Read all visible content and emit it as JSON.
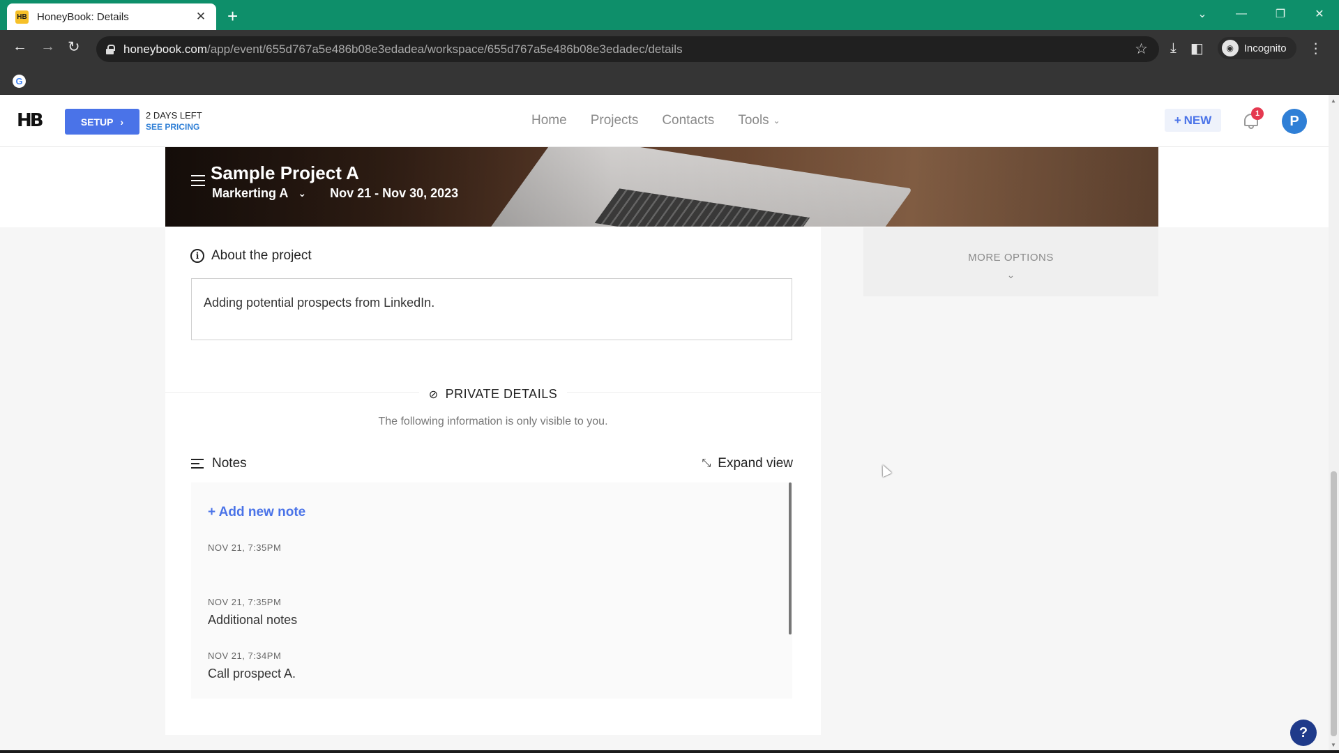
{
  "browser": {
    "tab_title": "HoneyBook: Details",
    "tab_favicon": "HB",
    "url_host": "honeybook.com",
    "url_path": "/app/event/655d767a5e486b08e3edadea/workspace/655d767a5e486b08e3edadec/details",
    "incognito_label": "Incognito"
  },
  "header": {
    "logo": "HB",
    "setup_label": "SETUP",
    "trial_days": "2 DAYS LEFT",
    "trial_pricing": "SEE PRICING",
    "nav": {
      "home": "Home",
      "projects": "Projects",
      "contacts": "Contacts",
      "tools": "Tools"
    },
    "new_label": "NEW",
    "notification_count": "1",
    "avatar_initial": "P"
  },
  "project": {
    "title": "Sample Project A",
    "pipeline": "Markerting A",
    "dates": "Nov 21 - Nov 30, 2023"
  },
  "about": {
    "heading": "About the project",
    "text": "Adding potential prospects from LinkedIn."
  },
  "private": {
    "heading": "PRIVATE DETAILS",
    "subtext": "The following information is only visible to you."
  },
  "notes": {
    "heading": "Notes",
    "expand_label": "Expand view",
    "add_label": "+ Add new note",
    "items": [
      {
        "date": "NOV 21, 7:35PM",
        "text": ""
      },
      {
        "date": "NOV 21, 7:35PM",
        "text": "Additional notes"
      },
      {
        "date": "NOV 21, 7:34PM",
        "text": "Call prospect A."
      }
    ]
  },
  "sidebar": {
    "more_options": "MORE OPTIONS"
  },
  "help_label": "?",
  "colors": {
    "tab_strip": "#0e8f6a",
    "accent": "#4a73e8",
    "badge": "#e53950",
    "avatar": "#2f7fd6"
  }
}
